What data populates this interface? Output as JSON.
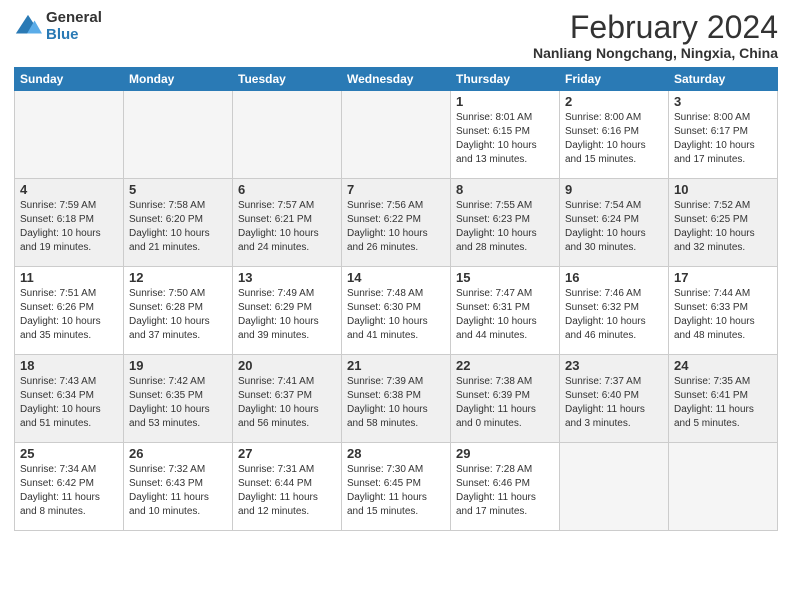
{
  "header": {
    "logo_general": "General",
    "logo_blue": "Blue",
    "main_title": "February 2024",
    "subtitle": "Nanliang Nongchang, Ningxia, China"
  },
  "days_of_week": [
    "Sunday",
    "Monday",
    "Tuesday",
    "Wednesday",
    "Thursday",
    "Friday",
    "Saturday"
  ],
  "weeks": [
    [
      {
        "day": "",
        "info": ""
      },
      {
        "day": "",
        "info": ""
      },
      {
        "day": "",
        "info": ""
      },
      {
        "day": "",
        "info": ""
      },
      {
        "day": "1",
        "info": "Sunrise: 8:01 AM\nSunset: 6:15 PM\nDaylight: 10 hours\nand 13 minutes."
      },
      {
        "day": "2",
        "info": "Sunrise: 8:00 AM\nSunset: 6:16 PM\nDaylight: 10 hours\nand 15 minutes."
      },
      {
        "day": "3",
        "info": "Sunrise: 8:00 AM\nSunset: 6:17 PM\nDaylight: 10 hours\nand 17 minutes."
      }
    ],
    [
      {
        "day": "4",
        "info": "Sunrise: 7:59 AM\nSunset: 6:18 PM\nDaylight: 10 hours\nand 19 minutes."
      },
      {
        "day": "5",
        "info": "Sunrise: 7:58 AM\nSunset: 6:20 PM\nDaylight: 10 hours\nand 21 minutes."
      },
      {
        "day": "6",
        "info": "Sunrise: 7:57 AM\nSunset: 6:21 PM\nDaylight: 10 hours\nand 24 minutes."
      },
      {
        "day": "7",
        "info": "Sunrise: 7:56 AM\nSunset: 6:22 PM\nDaylight: 10 hours\nand 26 minutes."
      },
      {
        "day": "8",
        "info": "Sunrise: 7:55 AM\nSunset: 6:23 PM\nDaylight: 10 hours\nand 28 minutes."
      },
      {
        "day": "9",
        "info": "Sunrise: 7:54 AM\nSunset: 6:24 PM\nDaylight: 10 hours\nand 30 minutes."
      },
      {
        "day": "10",
        "info": "Sunrise: 7:52 AM\nSunset: 6:25 PM\nDaylight: 10 hours\nand 32 minutes."
      }
    ],
    [
      {
        "day": "11",
        "info": "Sunrise: 7:51 AM\nSunset: 6:26 PM\nDaylight: 10 hours\nand 35 minutes."
      },
      {
        "day": "12",
        "info": "Sunrise: 7:50 AM\nSunset: 6:28 PM\nDaylight: 10 hours\nand 37 minutes."
      },
      {
        "day": "13",
        "info": "Sunrise: 7:49 AM\nSunset: 6:29 PM\nDaylight: 10 hours\nand 39 minutes."
      },
      {
        "day": "14",
        "info": "Sunrise: 7:48 AM\nSunset: 6:30 PM\nDaylight: 10 hours\nand 41 minutes."
      },
      {
        "day": "15",
        "info": "Sunrise: 7:47 AM\nSunset: 6:31 PM\nDaylight: 10 hours\nand 44 minutes."
      },
      {
        "day": "16",
        "info": "Sunrise: 7:46 AM\nSunset: 6:32 PM\nDaylight: 10 hours\nand 46 minutes."
      },
      {
        "day": "17",
        "info": "Sunrise: 7:44 AM\nSunset: 6:33 PM\nDaylight: 10 hours\nand 48 minutes."
      }
    ],
    [
      {
        "day": "18",
        "info": "Sunrise: 7:43 AM\nSunset: 6:34 PM\nDaylight: 10 hours\nand 51 minutes."
      },
      {
        "day": "19",
        "info": "Sunrise: 7:42 AM\nSunset: 6:35 PM\nDaylight: 10 hours\nand 53 minutes."
      },
      {
        "day": "20",
        "info": "Sunrise: 7:41 AM\nSunset: 6:37 PM\nDaylight: 10 hours\nand 56 minutes."
      },
      {
        "day": "21",
        "info": "Sunrise: 7:39 AM\nSunset: 6:38 PM\nDaylight: 10 hours\nand 58 minutes."
      },
      {
        "day": "22",
        "info": "Sunrise: 7:38 AM\nSunset: 6:39 PM\nDaylight: 11 hours\nand 0 minutes."
      },
      {
        "day": "23",
        "info": "Sunrise: 7:37 AM\nSunset: 6:40 PM\nDaylight: 11 hours\nand 3 minutes."
      },
      {
        "day": "24",
        "info": "Sunrise: 7:35 AM\nSunset: 6:41 PM\nDaylight: 11 hours\nand 5 minutes."
      }
    ],
    [
      {
        "day": "25",
        "info": "Sunrise: 7:34 AM\nSunset: 6:42 PM\nDaylight: 11 hours\nand 8 minutes."
      },
      {
        "day": "26",
        "info": "Sunrise: 7:32 AM\nSunset: 6:43 PM\nDaylight: 11 hours\nand 10 minutes."
      },
      {
        "day": "27",
        "info": "Sunrise: 7:31 AM\nSunset: 6:44 PM\nDaylight: 11 hours\nand 12 minutes."
      },
      {
        "day": "28",
        "info": "Sunrise: 7:30 AM\nSunset: 6:45 PM\nDaylight: 11 hours\nand 15 minutes."
      },
      {
        "day": "29",
        "info": "Sunrise: 7:28 AM\nSunset: 6:46 PM\nDaylight: 11 hours\nand 17 minutes."
      },
      {
        "day": "",
        "info": ""
      },
      {
        "day": "",
        "info": ""
      }
    ]
  ]
}
